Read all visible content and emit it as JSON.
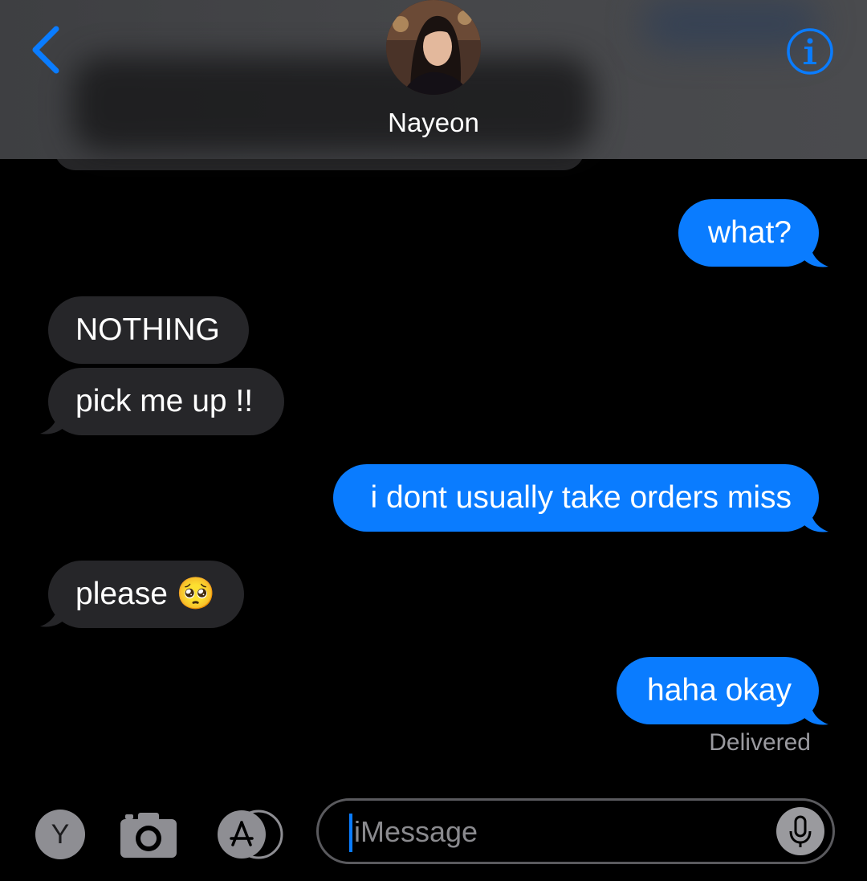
{
  "header": {
    "contact_name": "Nayeon",
    "accent_color": "#0a7cff"
  },
  "messages": [
    {
      "from": "me",
      "text": "what?"
    },
    {
      "from": "them",
      "text": "NOTHING"
    },
    {
      "from": "them",
      "text": "pick me up !!"
    },
    {
      "from": "me",
      "text": "i dont usually take orders miss"
    },
    {
      "from": "them",
      "text": "please 🥺"
    },
    {
      "from": "me",
      "text": "haha okay"
    }
  ],
  "status": "Delivered",
  "input": {
    "placeholder": "iMessage"
  },
  "toolbar": {
    "apps_button_letter": "Y"
  },
  "icons": [
    "back-chevron-icon",
    "info-icon",
    "camera-icon",
    "app-store-icon",
    "microphone-icon"
  ]
}
